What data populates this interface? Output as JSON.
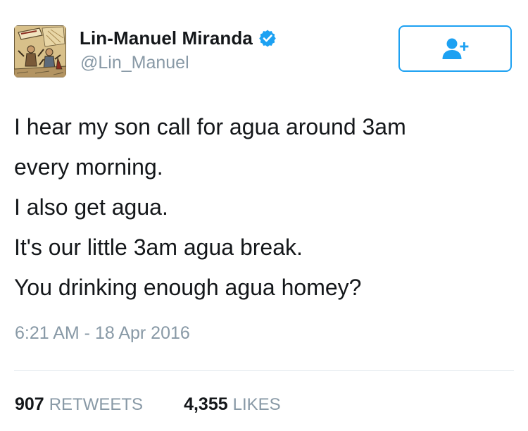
{
  "user": {
    "display_name": "Lin-Manuel Miranda",
    "handle": "@Lin_Manuel",
    "verified": true,
    "avatar_icon": "hamilton-comic-avatar"
  },
  "follow_button": {
    "icon": "add-user-icon",
    "color": "#1da1f2"
  },
  "tweet": {
    "lines": [
      "I hear my son call for agua around 3am",
      "every morning.",
      "I also get agua.",
      "It's our little 3am agua break.",
      "You drinking enough agua homey?"
    ],
    "timestamp": "6:21 AM - 18 Apr 2016"
  },
  "stats": {
    "retweets_count": "907",
    "retweets_label": "RETWEETS",
    "likes_count": "4,355",
    "likes_label": "LIKES"
  },
  "colors": {
    "accent": "#1da1f2",
    "muted_text": "#8899a6",
    "primary_text": "#14171a",
    "divider": "#e1e8ed"
  }
}
